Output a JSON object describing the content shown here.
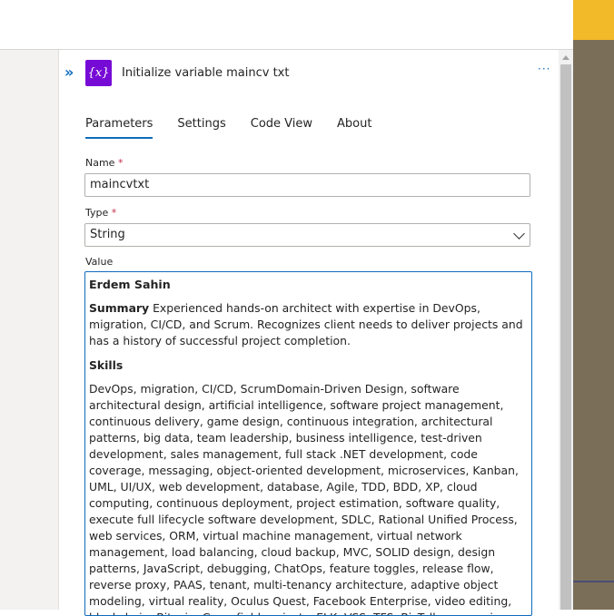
{
  "action": {
    "title": "Initialize variable maincv txt",
    "icon_label": "{x}",
    "more_label": "···",
    "collapse_label": "»"
  },
  "tabs": [
    {
      "label": "Parameters",
      "active": true
    },
    {
      "label": "Settings",
      "active": false
    },
    {
      "label": "Code View",
      "active": false
    },
    {
      "label": "About",
      "active": false
    }
  ],
  "fields": {
    "name_label": "Name",
    "name_required": "*",
    "name_value": "maincvtxt",
    "type_label": "Type",
    "type_required": "*",
    "type_value": "String",
    "value_label": "Value"
  },
  "value": {
    "person_name": "Erdem Sahin",
    "summary_heading": "Summary",
    "summary_text": " Experienced hands-on architect with expertise in DevOps, migration, CI/CD, and Scrum. Recognizes client needs to deliver projects and has a history of successful project completion.",
    "skills_heading": "Skills",
    "skills_text": "DevOps, migration, CI/CD, ScrumDomain-Driven Design, software architectural design, artificial intelligence, software project management, continuous delivery, game design, continuous integration, architectural patterns, big data, team leadership, business intelligence, test-driven development, sales management, full stack .NET development, code coverage, messaging, object-oriented development, microservices, Kanban, UML, UI/UX, web development, database, Agile, TDD, BDD, XP, cloud computing, continuous deployment, project estimation, software quality, execute full lifecycle software development, SDLC, Rational Unified Process, web services, ORM, virtual machine management, virtual network management, load balancing, cloud backup, MVC, SOLID design, design patterns, JavaScript, debugging, ChatOps, feature toggles, release flow, reverse proxy, PAAS, tenant, multi-tenancy architecture, adaptive object modeling, virtual reality, Oculus Quest, Facebook Enterprise, video editing, blockchain, Bitcoin, Greenfield projects, ELK, VSS, TFS, BizTalk, messaging"
  },
  "colors": {
    "accent": "#0f6cbd",
    "icon_bg": "#770bd6",
    "required": "#c4314b",
    "right_strip": "#7a6e58",
    "right_strip_top": "#f2b929"
  }
}
